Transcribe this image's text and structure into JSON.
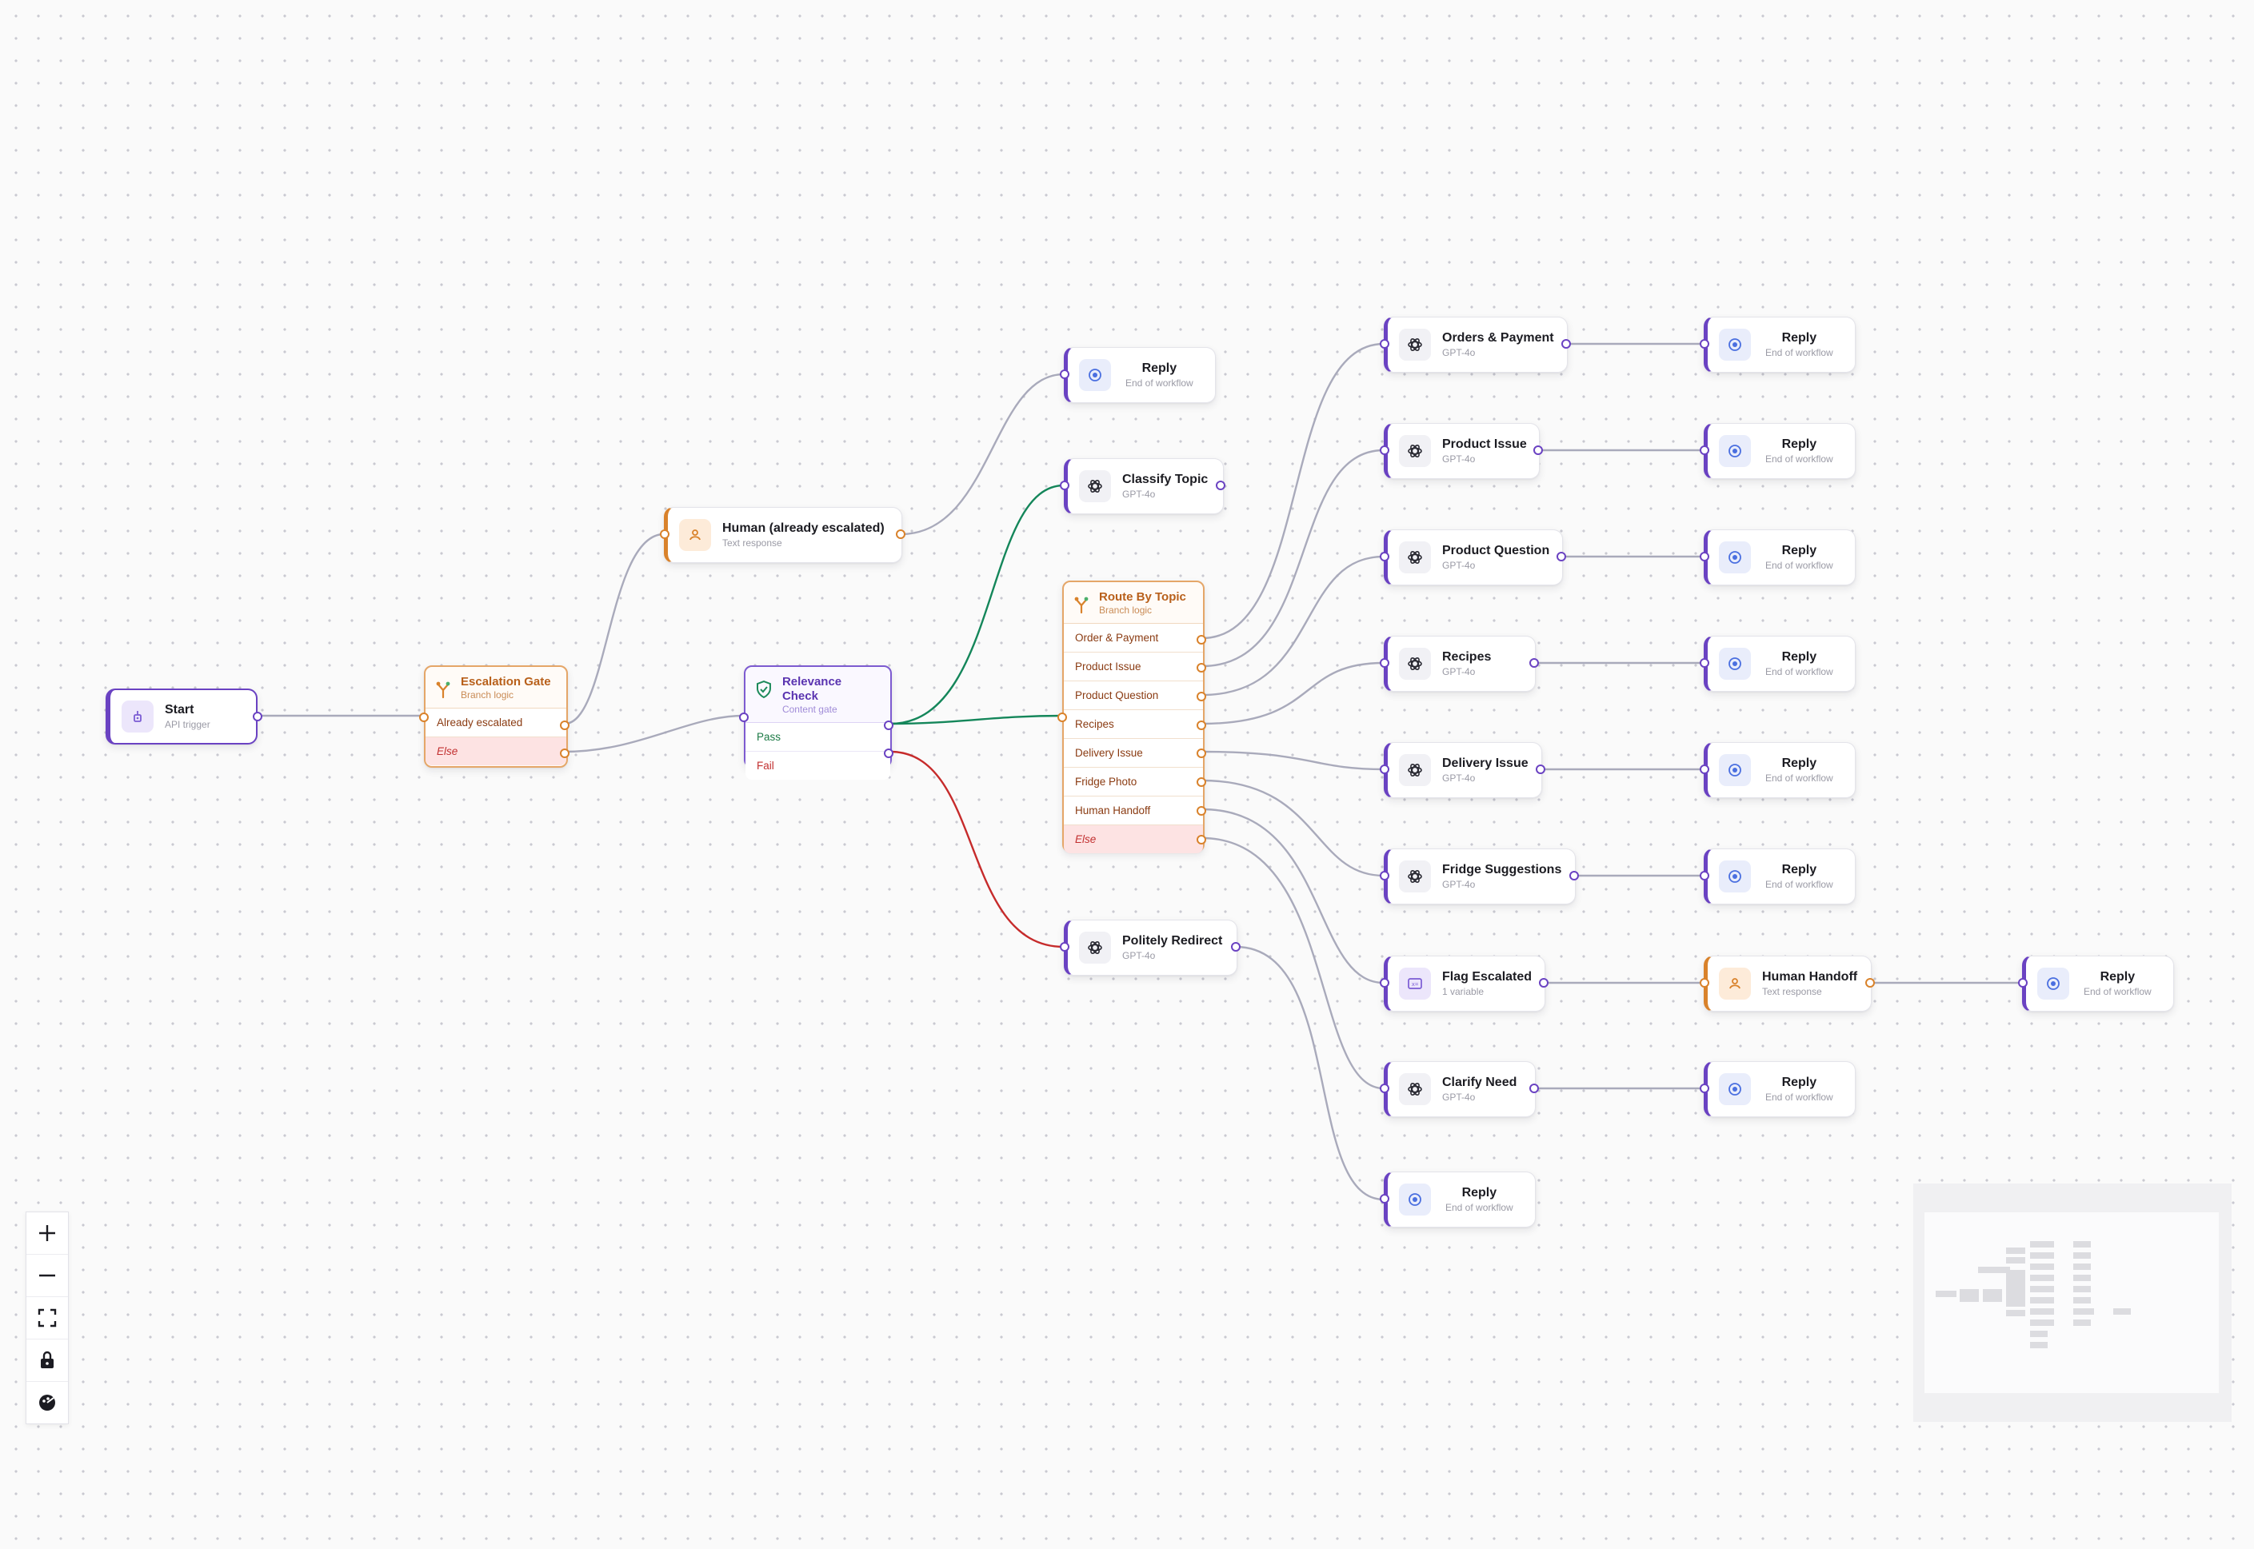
{
  "nodes": {
    "start": {
      "title": "Start",
      "subtitle": "API trigger"
    },
    "escalation_gate": {
      "title": "Escalation Gate",
      "subtitle": "Branch logic",
      "branches": [
        "Already escalated",
        "Else"
      ]
    },
    "human_escalated": {
      "title": "Human (already escalated)",
      "subtitle": "Text response"
    },
    "relevance_check": {
      "title": "Relevance Check",
      "subtitle": "Content gate",
      "branches": [
        "Pass",
        "Fail"
      ]
    },
    "reply_top": {
      "title": "Reply",
      "subtitle": "End of workflow"
    },
    "classify_topic": {
      "title": "Classify Topic",
      "subtitle": "GPT-4o"
    },
    "route_by_topic": {
      "title": "Route By Topic",
      "subtitle": "Branch logic",
      "branches": [
        "Order & Payment",
        "Product Issue",
        "Product Question",
        "Recipes",
        "Delivery Issue",
        "Fridge Photo",
        "Human Handoff",
        "Else"
      ]
    },
    "politely_redirect": {
      "title": "Politely Redirect",
      "subtitle": "GPT-4o"
    },
    "orders_payment": {
      "title": "Orders & Payment",
      "subtitle": "GPT-4o"
    },
    "product_issue": {
      "title": "Product Issue",
      "subtitle": "GPT-4o"
    },
    "product_question": {
      "title": "Product Question",
      "subtitle": "GPT-4o"
    },
    "recipes": {
      "title": "Recipes",
      "subtitle": "GPT-4o"
    },
    "delivery_issue": {
      "title": "Delivery Issue",
      "subtitle": "GPT-4o"
    },
    "fridge_suggestions": {
      "title": "Fridge Suggestions",
      "subtitle": "GPT-4o"
    },
    "flag_escalated": {
      "title": "Flag Escalated",
      "subtitle": "1 variable"
    },
    "clarify_need": {
      "title": "Clarify Need",
      "subtitle": "GPT-4o"
    },
    "reply_bottom": {
      "title": "Reply",
      "subtitle": "End of workflow"
    },
    "human_handoff": {
      "title": "Human Handoff",
      "subtitle": "Text response"
    },
    "reply_generic": {
      "title": "Reply",
      "subtitle": "End of workflow"
    }
  },
  "colors": {
    "purple": "#6a42c2",
    "orange": "#d9822b",
    "edge_gray": "#a9aabb",
    "edge_pass": "#14865a",
    "edge_fail": "#c62b2b"
  },
  "controls": [
    "zoom-in",
    "zoom-out",
    "fit-view",
    "lock",
    "theme"
  ]
}
